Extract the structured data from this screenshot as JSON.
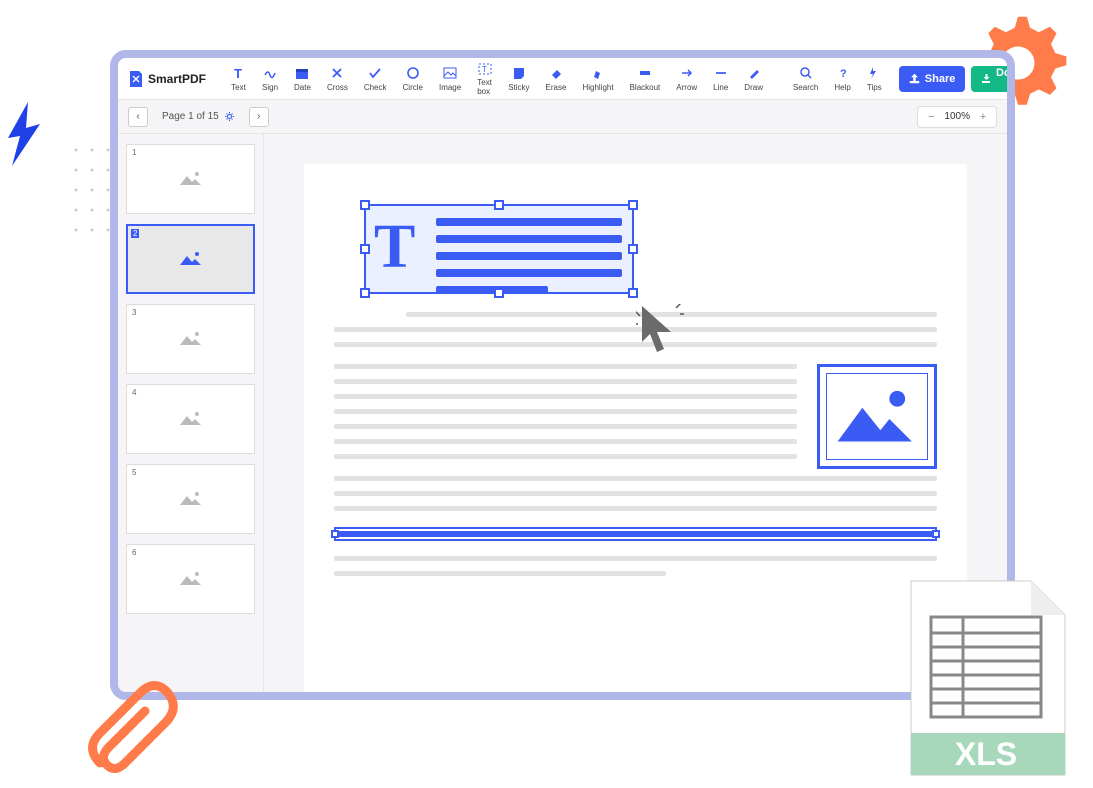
{
  "app": {
    "name": "SmartPDF"
  },
  "toolbar": {
    "tools": [
      {
        "label": "Text"
      },
      {
        "label": "Sign"
      },
      {
        "label": "Date"
      },
      {
        "label": "Cross"
      },
      {
        "label": "Check"
      },
      {
        "label": "Circle"
      },
      {
        "label": "Image"
      },
      {
        "label": "Text box"
      },
      {
        "label": "Sticky"
      },
      {
        "label": "Erase"
      },
      {
        "label": "Highlight"
      },
      {
        "label": "Blackout"
      },
      {
        "label": "Arrow"
      },
      {
        "label": "Line"
      },
      {
        "label": "Draw"
      }
    ],
    "utility": [
      {
        "label": "Search"
      },
      {
        "label": "Help"
      },
      {
        "label": "Tips"
      }
    ],
    "share": "Share",
    "download": "Download pdf"
  },
  "subbar": {
    "page_info": "Page 1 of 15",
    "zoom": "100%"
  },
  "thumbnails": [
    {
      "num": "1"
    },
    {
      "num": "2",
      "active": true
    },
    {
      "num": "3"
    },
    {
      "num": "4"
    },
    {
      "num": "5"
    },
    {
      "num": "6"
    }
  ],
  "decor": {
    "xls_label": "XLS"
  }
}
